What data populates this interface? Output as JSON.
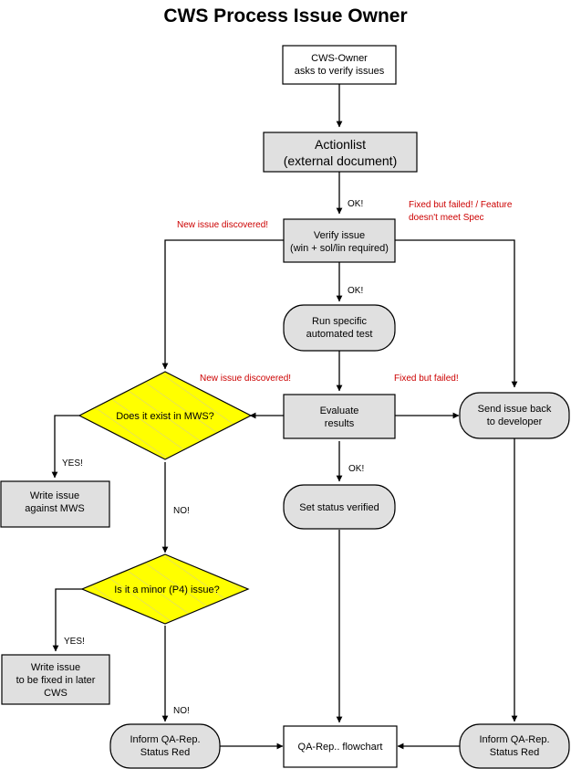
{
  "title": "CWS Process Issue Owner",
  "colors": {
    "fill_gray": "#e0e0e0",
    "fill_white": "#ffffff",
    "fill_yellow": "#ffff00",
    "stroke": "#000000",
    "label_red": "#cc0000",
    "label_black": "#000000"
  },
  "nodes": {
    "cws_owner": {
      "shape": "rect",
      "fill": "white",
      "line1": "CWS-Owner",
      "line2": "asks to verify issues"
    },
    "actionlist": {
      "shape": "rect",
      "fill": "gray",
      "line1": "Actionlist",
      "line2": "(external document)"
    },
    "verify_issue": {
      "shape": "rect",
      "fill": "gray",
      "line1": "Verify issue",
      "line2": "(win + sol/lin required)"
    },
    "run_test": {
      "shape": "rounded",
      "fill": "gray",
      "line1": "Run specific",
      "line2": "automated test"
    },
    "evaluate_results": {
      "shape": "rect",
      "fill": "gray",
      "line1": "Evaluate",
      "line2": "results"
    },
    "set_status_verified": {
      "shape": "rounded",
      "fill": "gray",
      "line1": "Set status verified"
    },
    "send_issue_back": {
      "shape": "rounded",
      "fill": "gray",
      "line1": "Send issue back",
      "line2": "to developer"
    },
    "exists_in_mws": {
      "shape": "diamond",
      "fill": "yellow",
      "line1": "Does it exist in MWS?"
    },
    "write_issue_mws": {
      "shape": "rect",
      "fill": "gray",
      "line1": "Write issue",
      "line2": "against MWS"
    },
    "minor_p4": {
      "shape": "diamond",
      "fill": "yellow",
      "line1": "Is it a minor (P4) issue?"
    },
    "write_issue_later": {
      "shape": "rect",
      "fill": "gray",
      "line1": "Write issue",
      "line2": "to be fixed in later",
      "line3": "CWS"
    },
    "inform_qa_left": {
      "shape": "rounded",
      "fill": "gray",
      "line1": "Inform QA-Rep.",
      "line2": "Status Red"
    },
    "qa_flowchart": {
      "shape": "rect",
      "fill": "white",
      "line1": "QA-Rep.. flowchart"
    },
    "inform_qa_right": {
      "shape": "rounded",
      "fill": "gray",
      "line1": "Inform QA-Rep.",
      "line2": "Status Red"
    }
  },
  "edge_labels": {
    "ok_actionlist_to_verify": "OK!",
    "new_issue_top": "New  issue discovered!",
    "fixed_failed_line1": "Fixed but failed! / Feature",
    "fixed_failed_line2": "doesn't meet Spec",
    "ok_verify_to_test": "OK!",
    "new_issue_mid": "New  issue discovered!",
    "fixed_but_failed": "Fixed but failed!",
    "yes_mws": "YES!",
    "no_mws": "NO!",
    "ok_evaluate": "OK!",
    "yes_p4": "YES!",
    "no_p4": "NO!"
  }
}
